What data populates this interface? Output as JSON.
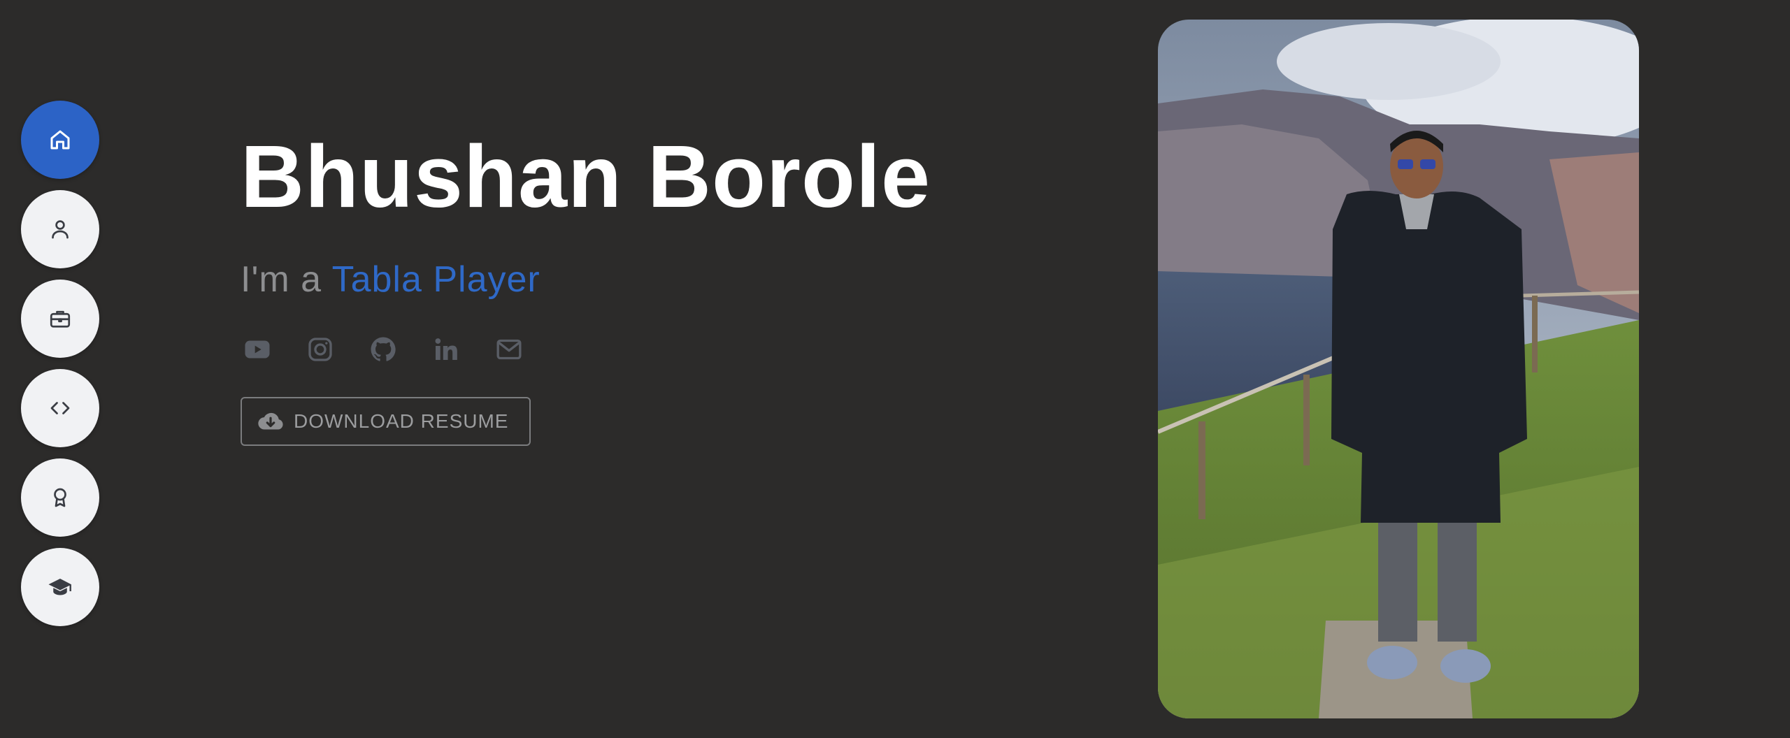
{
  "nav": {
    "items": [
      {
        "icon": "home-icon",
        "active": true
      },
      {
        "icon": "user-icon",
        "active": false
      },
      {
        "icon": "briefcase-icon",
        "active": false
      },
      {
        "icon": "code-icon",
        "active": false
      },
      {
        "icon": "award-icon",
        "active": false
      },
      {
        "icon": "graduation-cap-icon",
        "active": false
      }
    ]
  },
  "hero": {
    "name": "Bhushan Borole",
    "tagline_prefix": "I'm a ",
    "tagline_role": "Tabla Player"
  },
  "socials": [
    "youtube-icon",
    "instagram-icon",
    "github-icon",
    "linkedin-icon",
    "mail-icon"
  ],
  "resume_button": {
    "label": "DOWNLOAD RESUME",
    "icon": "cloud-download-icon"
  },
  "colors": {
    "background": "#2c2b2a",
    "accent": "#2c63c6",
    "nav_button": "#f1f2f4",
    "muted_text": "#8d8e90",
    "social_icon": "#5a5e66"
  }
}
